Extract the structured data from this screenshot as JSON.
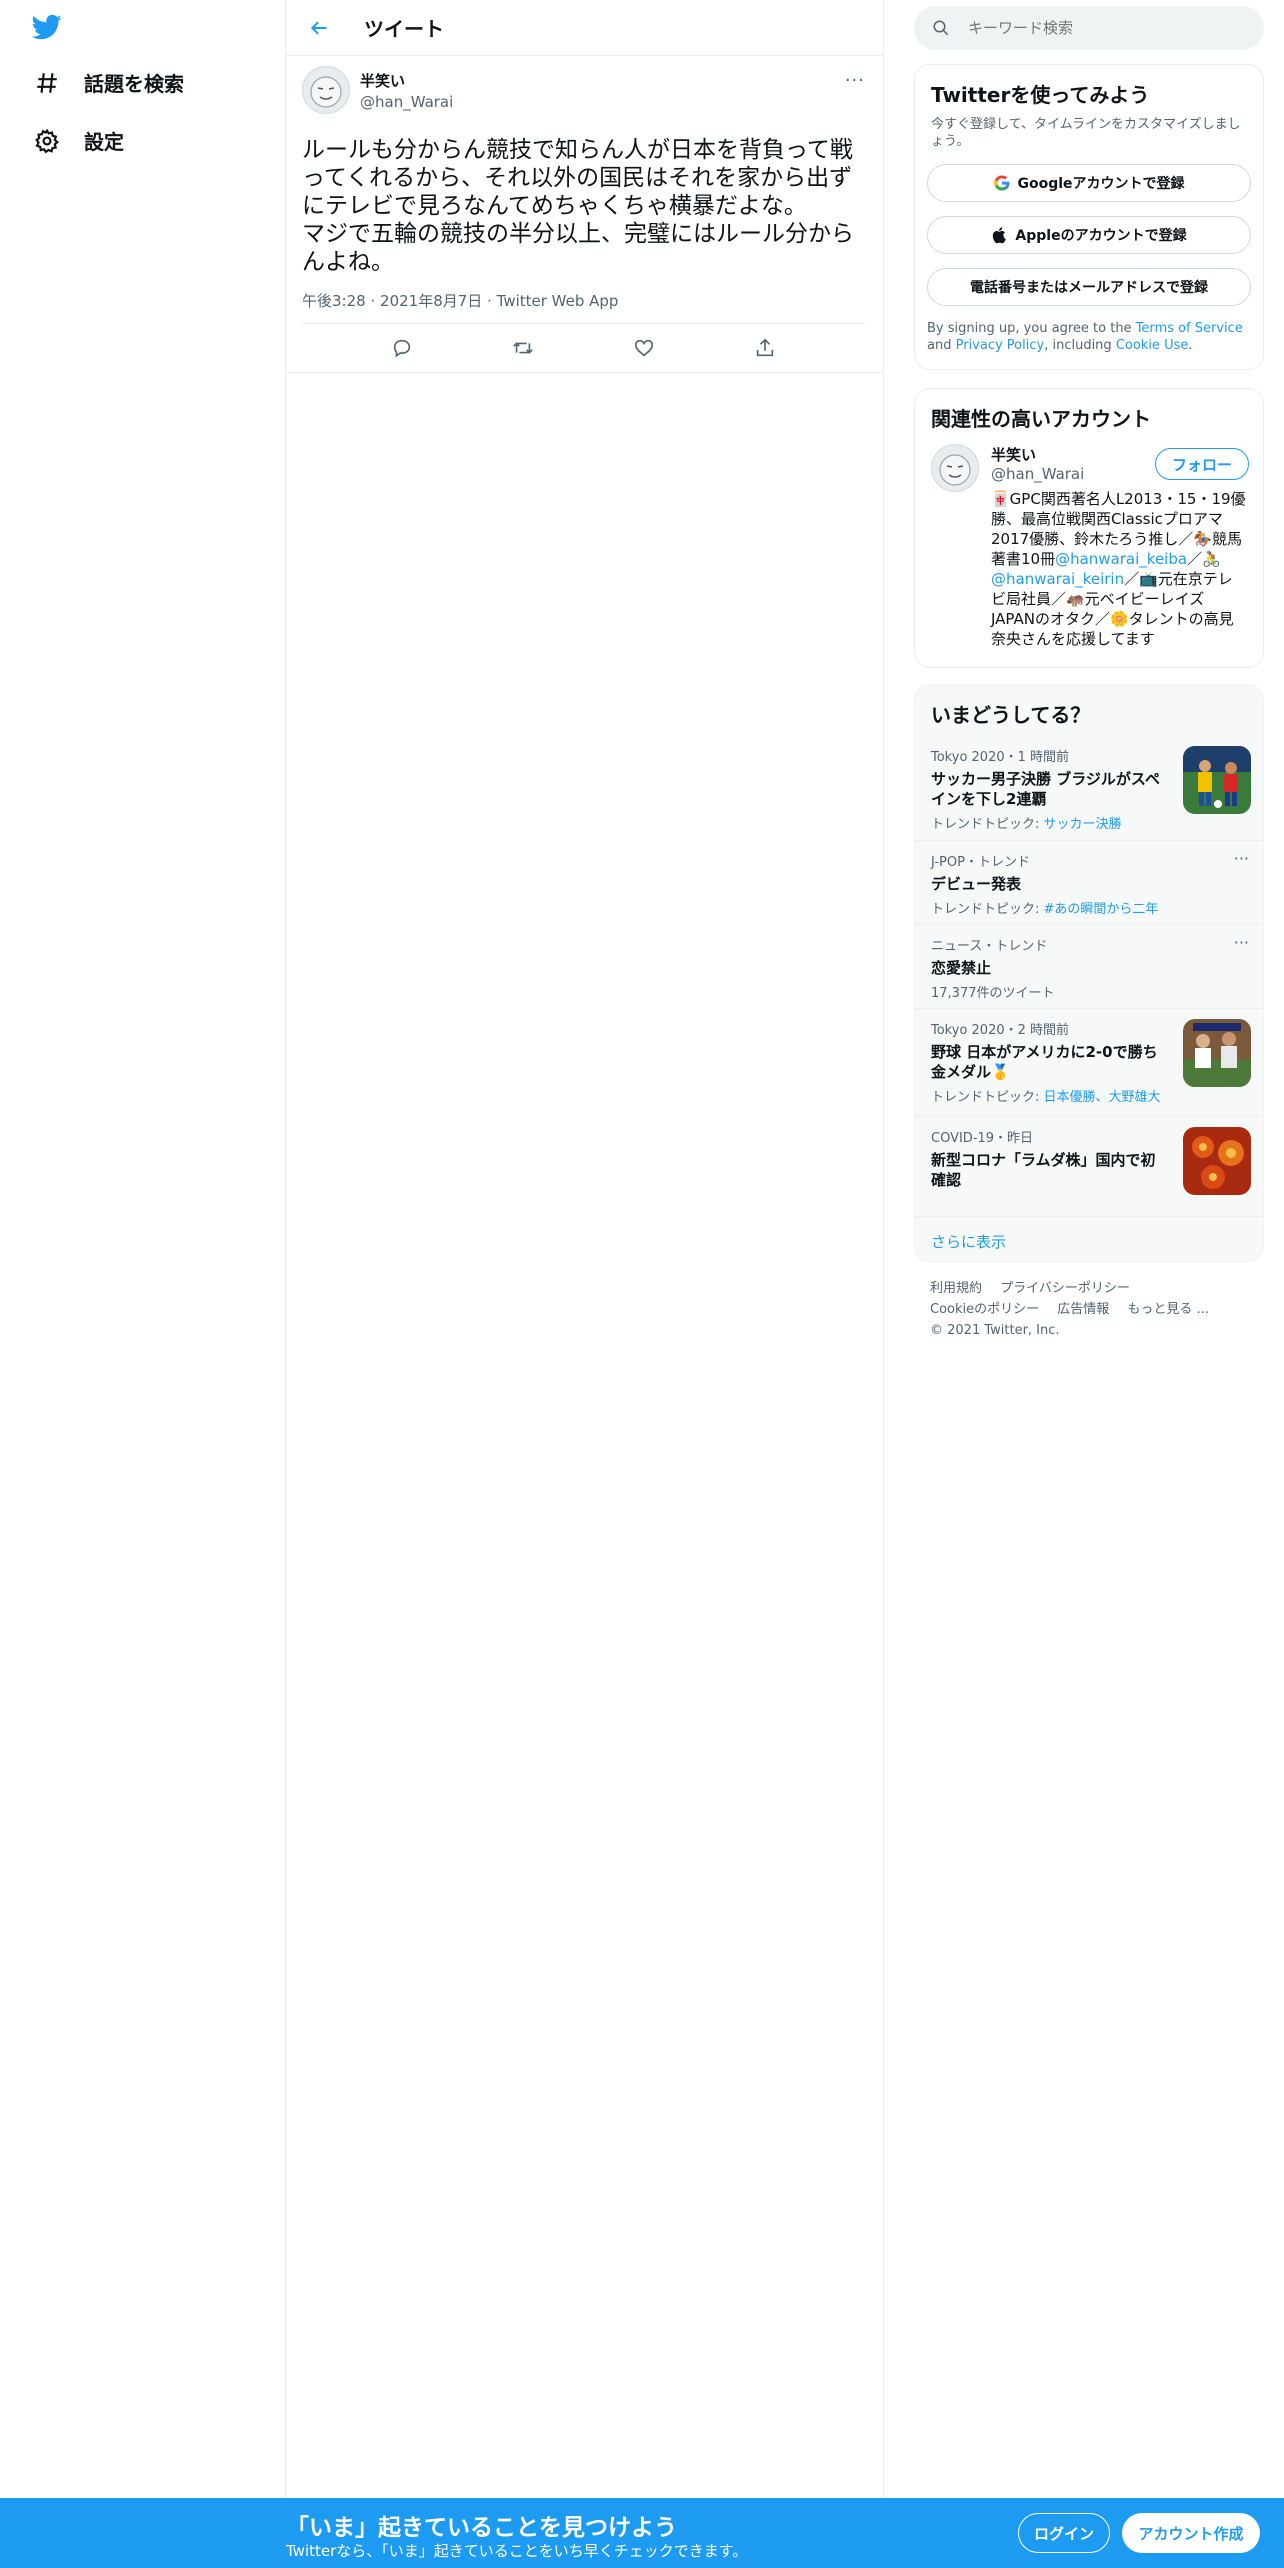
{
  "nav": {
    "logo_icon": "twitter-bird-icon",
    "items": [
      {
        "label": "話題を検索",
        "icon": "hashtag-icon"
      },
      {
        "label": "設定",
        "icon": "gear-icon"
      }
    ]
  },
  "header": {
    "title": "ツイート",
    "back_icon": "back-arrow-icon"
  },
  "tweet": {
    "author_name": "半笑い",
    "author_handle": "@han_Warai",
    "more": "···",
    "text": "ルールも分からん競技で知らん人が日本を背負って戦ってくれるから、それ以外の国民はそれを家から出ずにテレビで見ろなんてめちゃくちゃ横暴だよな。\nマジで五輪の競技の半分以上、完璧にはルール分からんよね。",
    "time": "午後3:28",
    "date": "2021年8月7日",
    "source": "Twitter Web App",
    "sep": "·"
  },
  "search": {
    "placeholder": "キーワード検索"
  },
  "signup": {
    "title": "Twitterを使ってみよう",
    "subtitle": "今すぐ登録して、タイムラインをカスタマイズしましょう。",
    "google": "Googleアカウントで登録",
    "apple": "Appleのアカウントで登録",
    "phone": "電話番号またはメールアドレスで登録",
    "terms_pre": "By signing up, you agree to the ",
    "terms_link": "Terms of Service",
    "terms_and": " and ",
    "privacy_link": "Privacy Policy",
    "terms_mid": ", including ",
    "cookie_link": "Cookie Use",
    "terms_end": "."
  },
  "related": {
    "title": "関連性の高いアカウント",
    "name": "半笑い",
    "handle": "@han_Warai",
    "follow": "フォロー",
    "bio_1": "🀄GPC関西著名人L2013・15・19優勝、最高位戦関西Classicプロアマ2017優勝、鈴木たろう推し／🏇競馬著書10冊",
    "bio_link1": "@hanwarai_keiba",
    "bio_2": "／🚴",
    "bio_link2": "@hanwarai_keirin",
    "bio_3": "／📺元在京テレビ局社員／🦛元ベイビーレイズJAPANのオタク／🌼タレントの高見奈央さんを応援してます"
  },
  "trends": {
    "title": "いまどうしてる？",
    "items": [
      {
        "meta": "Tokyo 2020・1 時間前",
        "title": "サッカー男子決勝 ブラジルがスペインを下し2連覇",
        "topic_label": "トレンドトピック: ",
        "topic_link": "サッカー決勝"
      },
      {
        "meta": "J-POP・トレンド",
        "title": "デビュー発表",
        "topic_label": "トレンドトピック: ",
        "topic_link": "#あの瞬間から二年",
        "dots": "···"
      },
      {
        "meta": "ニュース・トレンド",
        "title": "恋愛禁止",
        "topic_plain": "17,377件のツイート",
        "dots": "···"
      },
      {
        "meta": "Tokyo 2020・2 時間前",
        "title": "野球 日本がアメリカに2-0で勝ち金メダル🥇",
        "topic_label": "トレンドトピック: ",
        "topic_link": "日本優勝、大野雄大"
      },
      {
        "meta": "COVID-19・昨日",
        "title": "新型コロナ「ラムダ株」国内で初確認"
      }
    ],
    "show_more": "さらに表示"
  },
  "footer": {
    "links": [
      "利用規約",
      "プライバシーポリシー",
      "Cookieのポリシー",
      "広告情報",
      "もっと見る ..."
    ],
    "copyright": "© 2021 Twitter, Inc."
  },
  "bottom": {
    "title": "「いま」起きていることを見つけよう",
    "subtitle": "Twitterなら、「いま」起きていることをいち早くチェックできます。",
    "login": "ログイン",
    "signup": "アカウント作成"
  },
  "colors": {
    "accent": "#1d9bf0",
    "text": "#0f1419",
    "secondary": "#536471"
  }
}
